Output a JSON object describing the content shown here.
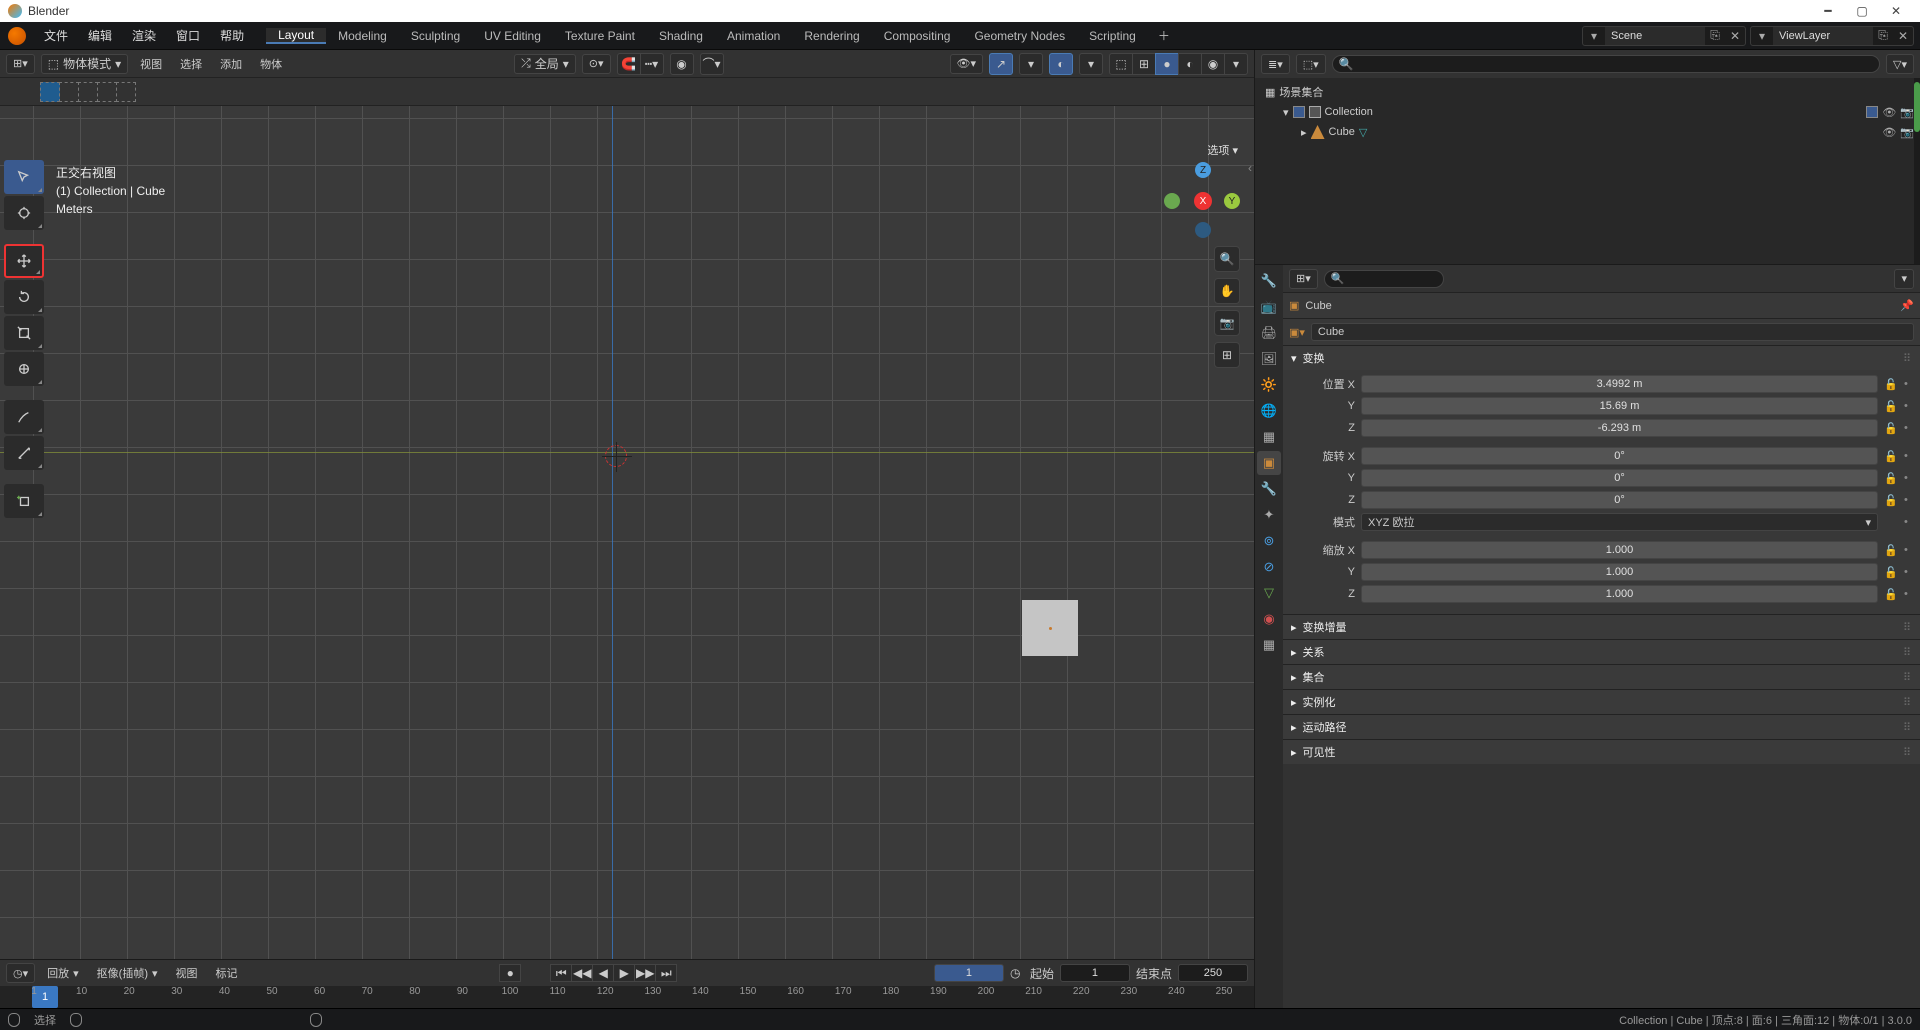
{
  "app_title": "Blender",
  "top_menu": {
    "file": "文件",
    "edit": "编辑",
    "render": "渲染",
    "window": "窗口",
    "help": "帮助"
  },
  "workspaces": [
    "Layout",
    "Modeling",
    "Sculpting",
    "UV Editing",
    "Texture Paint",
    "Shading",
    "Animation",
    "Rendering",
    "Compositing",
    "Geometry Nodes",
    "Scripting"
  ],
  "active_workspace": 0,
  "scene_label": "Scene",
  "viewlayer_label": "ViewLayer",
  "vp_header": {
    "mode": "物体模式",
    "view": "视图",
    "select": "选择",
    "add": "添加",
    "object": "物体",
    "orientation": "全局",
    "options": "选项"
  },
  "viewport_info": {
    "line1": "正交右视图",
    "line2": "(1) Collection | Cube",
    "line3": "Meters"
  },
  "gizmo": {
    "x": "X",
    "y": "Y",
    "z": "Z"
  },
  "outliner": {
    "scene": "场景集合",
    "collection": "Collection",
    "cube": "Cube"
  },
  "properties": {
    "search_placeholder": "",
    "obj_name": "Cube",
    "data_name": "Cube",
    "panels": {
      "transform": "变换",
      "delta": "变换增量",
      "relations": "关系",
      "collection": "集合",
      "instancing": "实例化",
      "motion_paths": "运动路径",
      "visibility": "可见性"
    },
    "labels": {
      "loc_x": "位置 X",
      "y": "Y",
      "z": "Z",
      "rot_x": "旋转 X",
      "mode": "模式",
      "mode_val": "XYZ 欧拉",
      "scale_x": "缩放 X"
    },
    "values": {
      "loc_x": "3.4992 m",
      "loc_y": "15.69 m",
      "loc_z": "-6.293 m",
      "rot_x": "0°",
      "rot_y": "0°",
      "rot_z": "0°",
      "scale_x": "1.000",
      "scale_y": "1.000",
      "scale_z": "1.000"
    }
  },
  "timeline": {
    "playback": "回放",
    "keying": "抠像(插帧)",
    "view": "视图",
    "marker": "标记",
    "current": "1",
    "start_lbl": "起始",
    "start": "1",
    "end_lbl": "结束点",
    "end": "250",
    "ticks": [
      1,
      10,
      20,
      30,
      40,
      50,
      60,
      70,
      80,
      90,
      100,
      110,
      120,
      130,
      140,
      150,
      160,
      170,
      180,
      190,
      200,
      210,
      220,
      230,
      240,
      250
    ]
  },
  "status": {
    "select": "选择",
    "right": "Collection | Cube | 顶点:8 | 面:6 | 三角面:12 | 物体:0/1 | 3.0.0"
  }
}
